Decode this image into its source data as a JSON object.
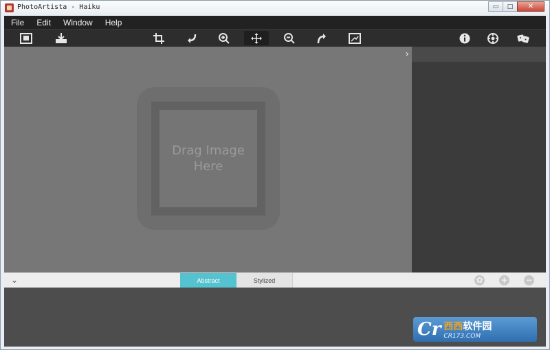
{
  "window": {
    "title": "PhotoArtista - Haiku"
  },
  "window_controls": {
    "minimize": "▭",
    "maximize": "□",
    "close": "✕"
  },
  "menu": [
    {
      "label": "File"
    },
    {
      "label": "Edit"
    },
    {
      "label": "Window"
    },
    {
      "label": "Help"
    }
  ],
  "toolbar": {
    "icons": [
      "open-image-icon",
      "save-image-icon",
      "crop-icon",
      "rotate-left-icon",
      "zoom-in-icon",
      "move-icon",
      "zoom-out-icon",
      "rotate-right-icon",
      "fit-image-icon",
      "info-icon",
      "settings-icon",
      "random-dice-icon"
    ],
    "active": "move-icon"
  },
  "canvas": {
    "drop_line1": "Drag Image",
    "drop_line2": "Here",
    "panel_toggle": "›"
  },
  "bottom_bar": {
    "collapse": "⌄",
    "tabs": [
      {
        "label": "Abstract",
        "active": true
      },
      {
        "label": "Stylized",
        "active": false
      }
    ],
    "buttons": {
      "palette": "✿",
      "add": "+",
      "remove": "−"
    }
  },
  "watermark": {
    "logo": "Cr",
    "name_part1": "西西",
    "name_part2": "软件园",
    "site": "CR173.COM"
  },
  "colors": {
    "accent": "#55c2d0",
    "canvas": "#777777",
    "toolbar": "#2d2d2d",
    "menubar": "#222222"
  }
}
